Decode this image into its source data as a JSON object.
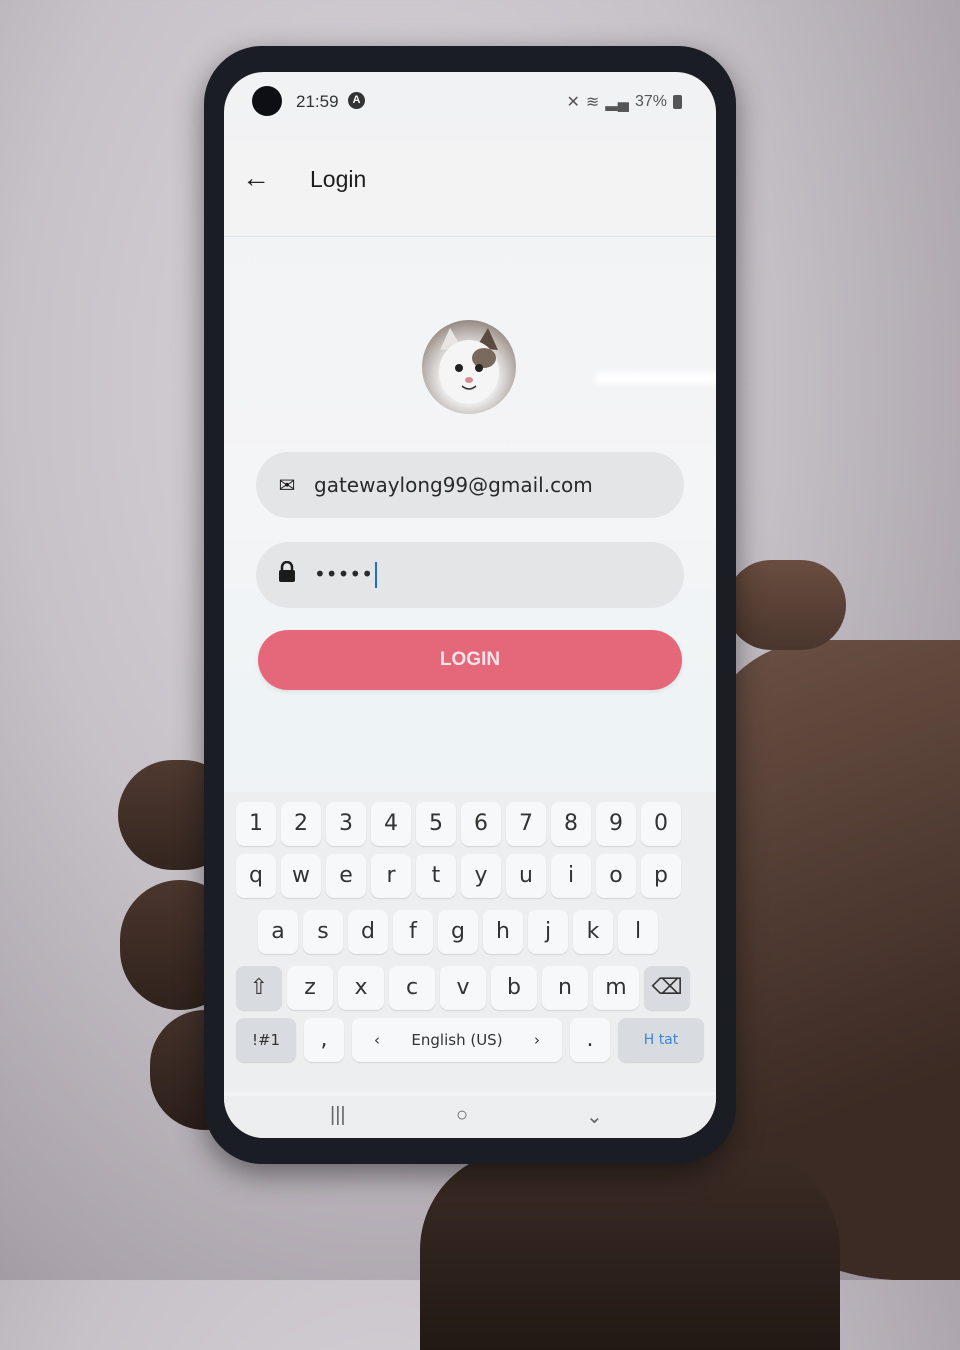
{
  "status": {
    "time": "21:59",
    "left_icon": "A",
    "battery": "37%"
  },
  "appbar": {
    "title": "Login",
    "back_icon": "←"
  },
  "form": {
    "email_icon": "✉",
    "email_value": "gatewaylong99@gmail.com",
    "lock_icon": "🔒",
    "password_value": "•••••",
    "login_label": "LOGIN"
  },
  "keyboard": {
    "row1": [
      "1",
      "2",
      "3",
      "4",
      "5",
      "6",
      "7",
      "8",
      "9",
      "0"
    ],
    "row2": [
      "q",
      "w",
      "e",
      "r",
      "t",
      "y",
      "u",
      "i",
      "o",
      "p"
    ],
    "row3": [
      "a",
      "s",
      "d",
      "f",
      "g",
      "h",
      "j",
      "k",
      "l"
    ],
    "row4": [
      "⇧",
      "z",
      "x",
      "c",
      "v",
      "b",
      "n",
      "m",
      "⌫"
    ],
    "row5": {
      "symbols": "!#1",
      "comma": ",",
      "left": "‹",
      "space": "English (US)",
      "right": "›",
      "period": ".",
      "action": "H tat"
    }
  },
  "navbar": {
    "recent": "|||",
    "home": "○",
    "back": "⌄"
  }
}
